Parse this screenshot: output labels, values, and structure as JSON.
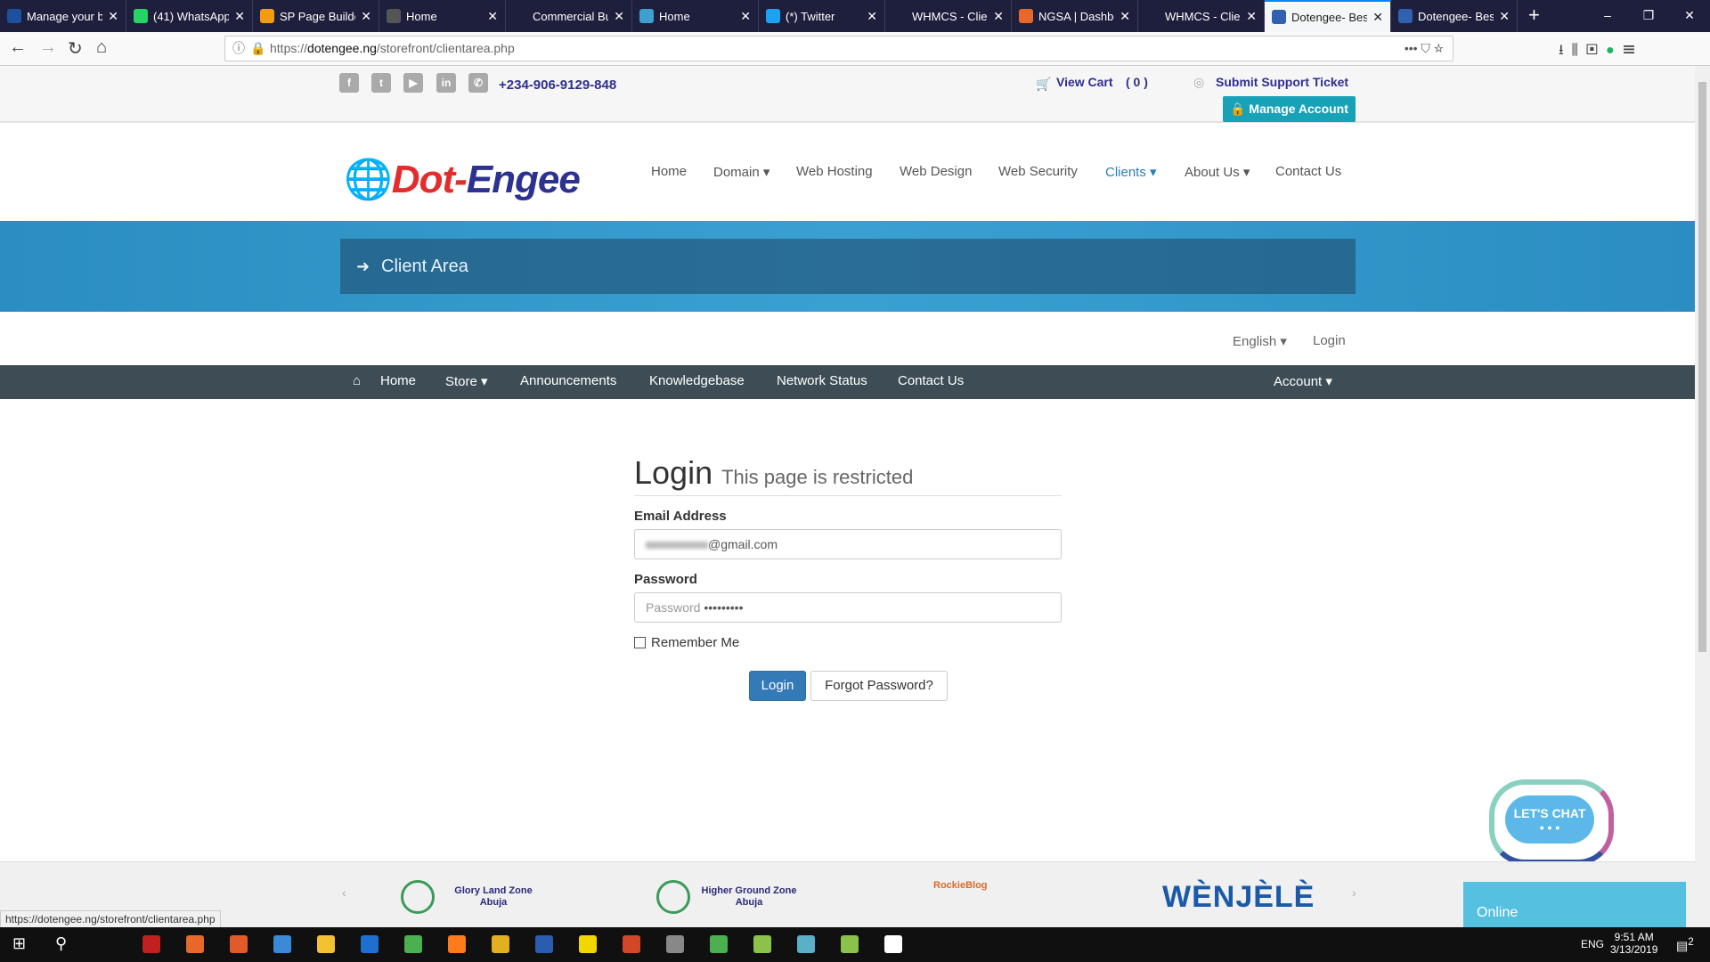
{
  "browser": {
    "tabs": [
      {
        "title": "Manage your b",
        "color": "#1e50a0"
      },
      {
        "title": "(41) WhatsApp",
        "color": "#25d366"
      },
      {
        "title": "SP Page Builder",
        "color": "#f39c12"
      },
      {
        "title": "Home",
        "color": "#555"
      },
      {
        "title": "Commercial Busine",
        "color": "#1d1f3d"
      },
      {
        "title": "Home",
        "color": "#3fa0d0"
      },
      {
        "title": "(*) Twitter",
        "color": "#1da1f2"
      },
      {
        "title": "WHMCS - Client Pr",
        "color": "#1d1f3d"
      },
      {
        "title": "NGSA | Dashbo",
        "color": "#e8672b"
      },
      {
        "title": "WHMCS - Client Pr",
        "color": "#1d1f3d"
      },
      {
        "title": "Dotengee- Best",
        "color": "#3060b0",
        "active": true
      },
      {
        "title": "Dotengee- Best",
        "color": "#3060b0"
      }
    ],
    "url_host": "dotengee.ng",
    "url_prefix": "https://",
    "url_path": "/storefront/clientarea.php",
    "status_url": "https://dotengee.ng/storefront/clientarea.php"
  },
  "topbar": {
    "phone": "+234-906-9129-848",
    "view_cart": "View Cart",
    "cart_count": "( 0 )",
    "support": "Submit Support Ticket",
    "manage_account": "Manage Account"
  },
  "logo": {
    "part1": "Dot-",
    "part2": "Engee"
  },
  "main_nav": [
    "Home",
    "Domain ▾",
    "Web Hosting",
    "Web Design",
    "Web Security",
    "Clients ▾",
    "About Us ▾",
    "Contact Us"
  ],
  "accent": "#2a7fb8",
  "banner": {
    "title": "Client Area"
  },
  "secondary": {
    "language": "English ▾",
    "login": "Login"
  },
  "client_nav": {
    "items": [
      "Home",
      "Store ▾",
      "Announcements",
      "Knowledgebase",
      "Network Status",
      "Contact Us"
    ],
    "account": "Account ▾"
  },
  "form": {
    "title": "Login",
    "subtitle": "This page is restricted",
    "email_label": "Email Address",
    "email_value": "@gmail.com",
    "password_label": "Password",
    "password_placeholder": "Password",
    "password_value": "•••••••••",
    "remember": "Remember Me",
    "login_btn": "Login",
    "forgot_btn": "Forgot Password?"
  },
  "partners": [
    "Glory Land Zone Abuja",
    "Higher Ground Zone Abuja",
    "RockieBlog",
    "WÈNJÈLÈ"
  ],
  "chat": {
    "bubble": "LET'S CHAT",
    "status": "Online"
  },
  "taskbar": {
    "time": "9:51 AM",
    "date": "3/13/2019",
    "lang": "ENG",
    "notifications": "2"
  }
}
